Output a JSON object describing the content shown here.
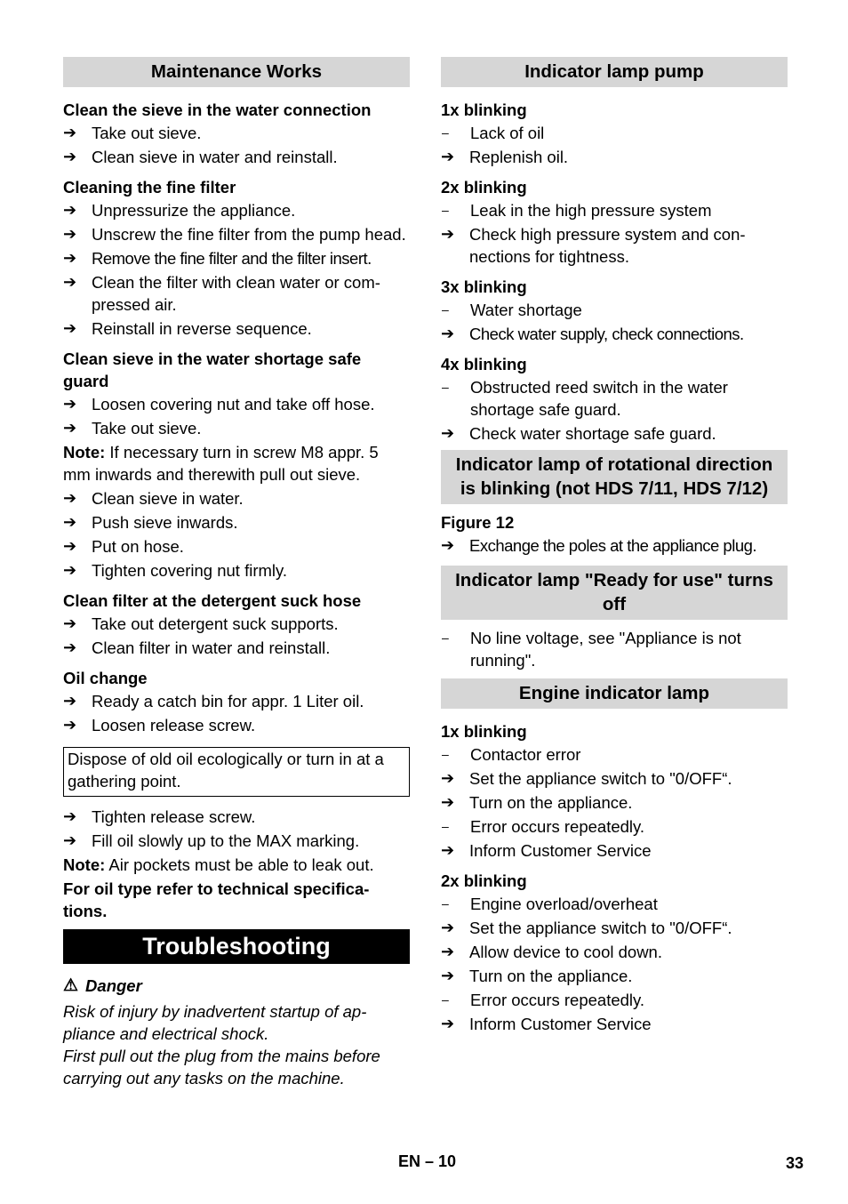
{
  "left": {
    "maintenance_header": "Maintenance Works",
    "s1": {
      "title": "Clean the sieve in the water connection",
      "items": [
        "Take out sieve.",
        "Clean sieve in water and reinstall."
      ]
    },
    "s2": {
      "title": "Cleaning the fine filter",
      "items": [
        "Unpressurize the appliance.",
        "Unscrew the fine filter from the pump head.",
        "Remove the fine filter and the filter insert.",
        "Clean the filter with clean water or com-pressed air.",
        "Reinstall in reverse sequence."
      ]
    },
    "s3": {
      "title": "Clean sieve in the water shortage safe guard",
      "items_a": [
        "Loosen covering nut and take off hose.",
        "Take out sieve."
      ],
      "note_label": "Note:",
      "note_text": " If necessary turn in screw M8 appr. 5 mm inwards and therewith pull out sieve.",
      "items_b": [
        "Clean sieve in water.",
        "Push sieve inwards.",
        "Put on hose.",
        "Tighten covering nut firmly."
      ]
    },
    "s4": {
      "title": "Clean filter at the detergent suck hose",
      "items": [
        "Take out detergent suck supports.",
        "Clean filter in water and reinstall."
      ]
    },
    "s5": {
      "title": "Oil change",
      "items_a": [
        "Ready a catch bin for appr. 1 Liter oil.",
        "Loosen release screw."
      ],
      "box": "Dispose of old oil ecologically or turn in at a gathering point.",
      "items_b": [
        "Tighten release screw.",
        "Fill oil slowly up to the MAX marking."
      ],
      "note_label": "Note:",
      "note_text": " Air pockets must be able to leak out.",
      "bold_note": "For oil type refer to technical specifica-tions."
    },
    "troubleshooting_header": "Troubleshooting",
    "danger": {
      "icon": "warning-triangle-icon",
      "title": "Danger",
      "p1": "Risk of injury by inadvertent startup of ap-pliance and electrical shock.",
      "p2": "First pull out the plug from the mains before carrying out any tasks on the machine."
    }
  },
  "right": {
    "pump_header": "Indicator lamp pump",
    "pump": [
      {
        "title": "1x blinking",
        "cause": "Lack of oil",
        "actions": [
          "Replenish oil."
        ]
      },
      {
        "title": "2x blinking",
        "cause": "Leak in the high pressure system",
        "actions": [
          "Check high pressure system and con-nections for tightness."
        ]
      },
      {
        "title": "3x blinking",
        "cause": "Water shortage",
        "actions": [
          "Check water supply, check connections."
        ]
      },
      {
        "title": "4x blinking",
        "cause": "Obstructed reed switch in the water shortage safe guard.",
        "actions": [
          "Check water shortage safe guard."
        ]
      }
    ],
    "rotation_header": "Indicator lamp of rotational direction is blinking (not HDS 7/11, HDS 7/12)",
    "figure_label": "Figure 12",
    "rotation_action": "Exchange the poles at the appliance plug.",
    "ready_header": "Indicator lamp \"Ready for use\" turns off",
    "ready_cause": "No line voltage, see \"Appliance is not running\".",
    "engine_header": "Engine indicator lamp",
    "engine1": {
      "title": "1x blinking",
      "lines": [
        {
          "type": "dash",
          "text": "Contactor error"
        },
        {
          "type": "arrow",
          "text": "Set the appliance switch to \"0/OFF“."
        },
        {
          "type": "arrow",
          "text": "Turn on the appliance."
        },
        {
          "type": "dash",
          "text": "Error occurs repeatedly."
        },
        {
          "type": "arrow",
          "text": "Inform Customer Service"
        }
      ]
    },
    "engine2": {
      "title": "2x blinking",
      "lines": [
        {
          "type": "dash",
          "text": "Engine overload/overheat"
        },
        {
          "type": "arrow",
          "text": "Set the appliance switch to \"0/OFF“."
        },
        {
          "type": "arrow",
          "text": "Allow device to cool down."
        },
        {
          "type": "arrow",
          "text": "Turn on the appliance."
        },
        {
          "type": "dash",
          "text": "Error occurs repeatedly."
        },
        {
          "type": "arrow",
          "text": "Inform Customer Service"
        }
      ]
    }
  },
  "markers": {
    "arrow": "➔",
    "dash": "–"
  },
  "footer": {
    "left": "EN – 10",
    "page_number": "33"
  }
}
